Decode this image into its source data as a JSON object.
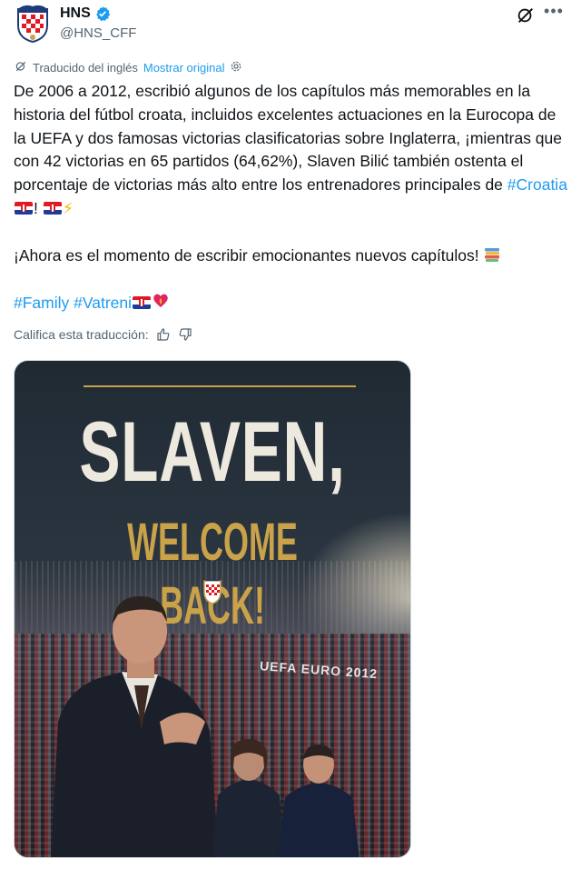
{
  "account": {
    "name": "HNS",
    "handle": "@HNS_CFF"
  },
  "translation": {
    "label": "Traducido del inglés",
    "show_original": "Mostrar original"
  },
  "tweet": {
    "p1_a": "De 2006 a 2012, escribió algunos de los capítulos más memorables en la historia del fútbol croata, incluidos excelentes actuaciones en la Eurocopa de la UEFA y dos famosas victorias clasificatorias sobre Inglaterra, ¡mientras que con 42 victorias en 65 partidos (64,62%), Slaven Bilić también ostenta el porcentaje de victorias más alto entre los entrenadores principales de ",
    "hashtag_croatia": "#Croatia",
    "p1_b": "! ",
    "p2": "¡Ahora es el momento de escribir emocionantes nuevos capítulos! ",
    "hashtag_family": "#Family",
    "hashtag_vatreni": "#Vatreni"
  },
  "rate": {
    "label": "Califica esta traducción:"
  },
  "media": {
    "headline": "SLAVEN,",
    "subheadline": "WELCOME BACK!",
    "banner_text": "UEFA EURO 2012"
  },
  "icons": {
    "verified": "verified-badge-icon",
    "grok": "grok-icon",
    "more": "more-icon",
    "translate": "translate-icon",
    "settings": "settings-gear-icon",
    "thumbs_up": "thumbs-up-icon",
    "thumbs_down": "thumbs-down-icon",
    "bolt": "lightning-emoji",
    "books": "books-emoji",
    "heart": "heart-fire-emoji"
  },
  "colors": {
    "link": "#1d9bf0",
    "gold": "#c9a24a",
    "verified": "#1d9bf0"
  }
}
